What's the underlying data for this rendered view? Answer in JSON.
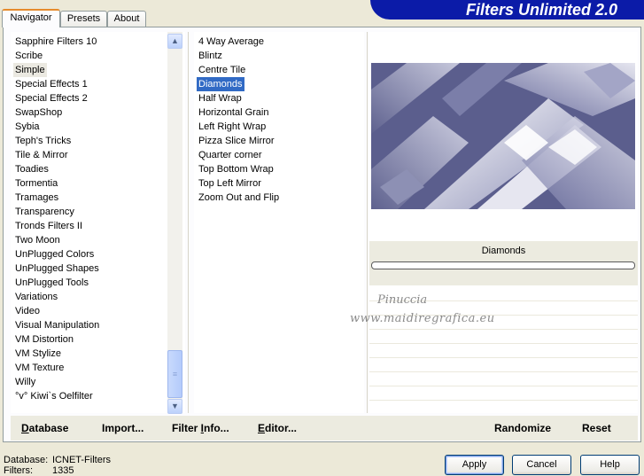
{
  "tabs": [
    {
      "label": "Navigator",
      "active": true
    },
    {
      "label": "Presets",
      "active": false
    },
    {
      "label": "About",
      "active": false
    }
  ],
  "banner": {
    "title": "Filters Unlimited 2.0"
  },
  "categories": {
    "items": [
      "Sapphire Filters 10",
      "Scribe",
      "Simple",
      "Special Effects 1",
      "Special Effects 2",
      "SwapShop",
      "Sybia",
      "Teph's Tricks",
      "Tile & Mirror",
      "Toadies",
      "Tormentia",
      "Tramages",
      "Transparency",
      "Tronds Filters II",
      "Two Moon",
      "UnPlugged Colors",
      "UnPlugged Shapes",
      "UnPlugged Tools",
      "Variations",
      "Video",
      "Visual Manipulation",
      "VM Distortion",
      "VM Stylize",
      "VM Texture",
      "Willy",
      "°v° Kiwi`s Oelfilter"
    ],
    "selected": "Simple"
  },
  "filters": {
    "items": [
      "4 Way Average",
      "Blintz",
      "Centre Tile",
      "Diamonds",
      "Half Wrap",
      "Horizontal Grain",
      "Left Right Wrap",
      "Pizza Slice Mirror",
      "Quarter corner",
      "Top Bottom Wrap",
      "Top Left Mirror",
      "Zoom Out and Flip"
    ],
    "selected": "Diamonds"
  },
  "preview": {
    "filter_name": "Diamonds",
    "colors": {
      "dark": "#5a5d8c",
      "light": "#dddde8",
      "mid": "#9b9dbf"
    }
  },
  "watermark": {
    "line1": "Pinuccia",
    "line2": "www.maidiregrafica.eu"
  },
  "toolbar": {
    "database": {
      "pre": "",
      "key": "D",
      "post": "atabase"
    },
    "import": {
      "pre": "Import",
      "key": "",
      "post": "..."
    },
    "filter_info": {
      "pre": "Filter ",
      "key": "I",
      "post": "nfo..."
    },
    "editor": {
      "pre": "",
      "key": "E",
      "post": "ditor..."
    },
    "randomize": "Randomize",
    "reset": "Reset"
  },
  "status": {
    "database_label": "Database:",
    "database_value": "ICNET-Filters",
    "filters_label": "Filters:",
    "filters_value": "1335"
  },
  "buttons": {
    "apply": "Apply",
    "cancel": "Cancel",
    "help": "Help"
  },
  "icons": {
    "scroll_up": "chevron-up-icon",
    "scroll_down": "chevron-down-icon",
    "grip": "grip-icon"
  }
}
